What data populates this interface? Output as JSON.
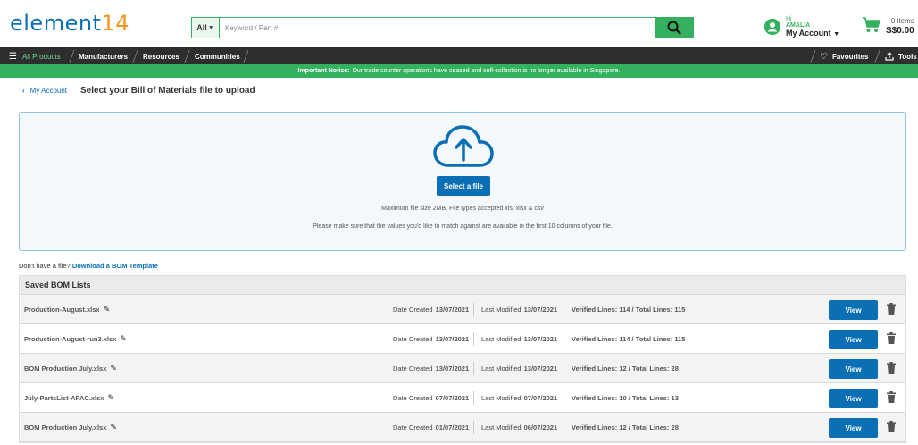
{
  "header": {
    "logo_text": "element",
    "logo_num": "14",
    "search_scope": "All",
    "search_placeholder": "Keyword / Part #",
    "greeting": "Hi",
    "user_name": "AMALIA",
    "my_account": "My Account",
    "cart_items": "0 items",
    "cart_total": "S$0.00"
  },
  "nav": {
    "all_products": "All Products",
    "manufacturers": "Manufacturers",
    "resources": "Resources",
    "communities": "Communities",
    "favourites": "Favourites",
    "tools": "Tools"
  },
  "notice": {
    "bold": "Important Notice:",
    "text": "Our trade counter operations have ceased and self-collection is no longer available in Singapore."
  },
  "breadcrumb": {
    "back": "My Account"
  },
  "page_title": "Select your Bill of Materials file to upload",
  "upload": {
    "button": "Select a file",
    "hint1": "Maximum file size 2MB. File types accepted xls, xlsx & csv",
    "hint2": "Please make sure that the values you'd like to match against are available in the first 10 columns of your file."
  },
  "no_file": {
    "text": "Don't have a file?",
    "link": "Download a BOM Template"
  },
  "saved": {
    "title": "Saved BOM Lists",
    "labels": {
      "created": "Date Created",
      "modified": "Last Modified",
      "view": "View"
    },
    "rows": [
      {
        "name": "Production-August.xlsx",
        "created": "13/07/2021",
        "modified": "13/07/2021",
        "lines": "Verified Lines: 114 / Total Lines: 115"
      },
      {
        "name": "Production-August-run3.xlsx",
        "created": "13/07/2021",
        "modified": "13/07/2021",
        "lines": "Verified Lines: 114 / Total Lines: 115"
      },
      {
        "name": "BOM Production July.xlsx",
        "created": "13/07/2021",
        "modified": "13/07/2021",
        "lines": "Verified Lines: 12 / Total Lines: 28"
      },
      {
        "name": "July-PartsList-APAC.xlsx",
        "created": "07/07/2021",
        "modified": "07/07/2021",
        "lines": "Verified Lines: 10 / Total Lines: 13"
      },
      {
        "name": "BOM Production July.xlsx",
        "created": "01/07/2021",
        "modified": "06/07/2021",
        "lines": "Verified Lines: 12 / Total Lines: 28"
      }
    ]
  },
  "colors": {
    "brand_blue": "#0a6fb5",
    "brand_green": "#34b15e",
    "nav_dark": "#2e2e2e",
    "logo_orange": "#f7941d"
  }
}
